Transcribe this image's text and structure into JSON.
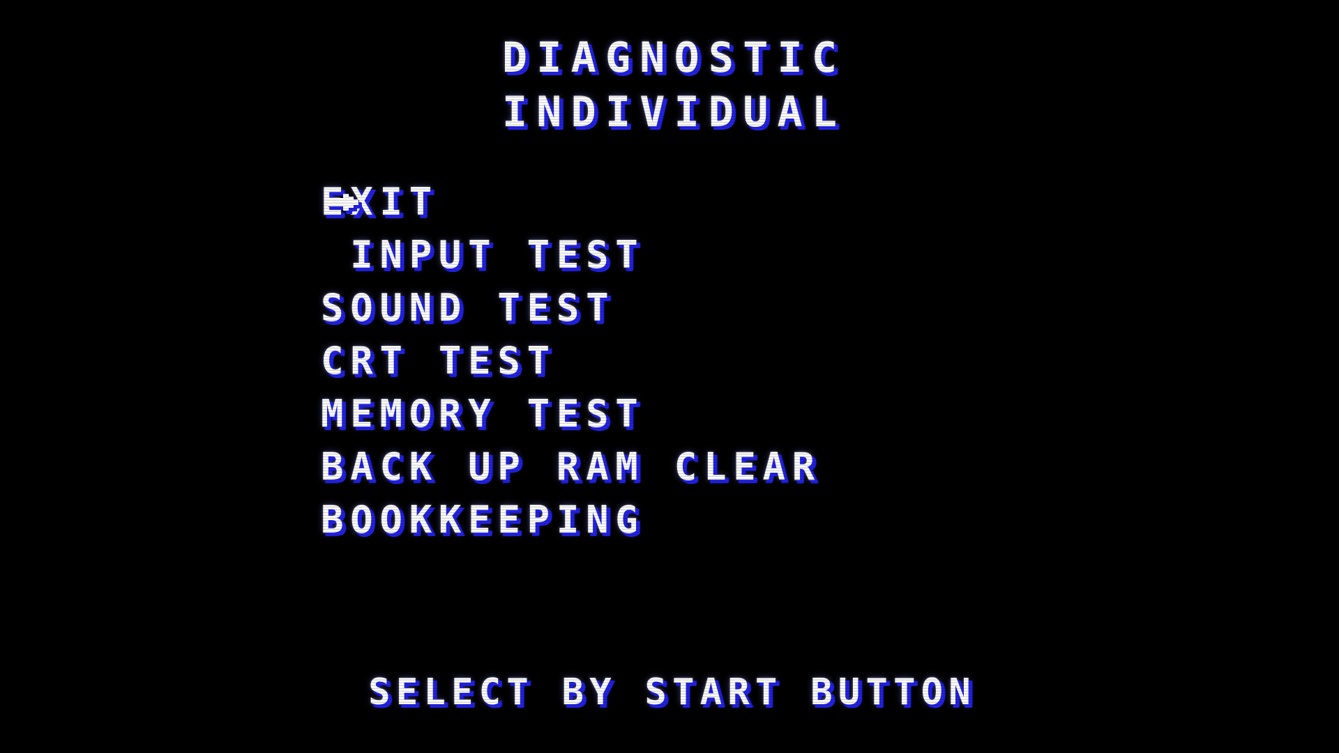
{
  "screen": {
    "background_color": "#000000",
    "text_color": "#ffffff",
    "shadow_color": "#2222e6"
  },
  "title": {
    "line1": "DIAGNOSTIC",
    "line2": "INDIVIDUAL"
  },
  "cursor": {
    "icon": "arrow-right-icon",
    "selected_index": 0
  },
  "menu": {
    "items": [
      {
        "label": "EXIT",
        "selected": true
      },
      {
        "label": " INPUT TEST",
        "selected": false
      },
      {
        "label": "SOUND TEST",
        "selected": false
      },
      {
        "label": "CRT TEST",
        "selected": false
      },
      {
        "label": "MEMORY TEST",
        "selected": false
      },
      {
        "label": "BACK UP RAM CLEAR",
        "selected": false
      },
      {
        "label": "BOOKKEEPING",
        "selected": false
      }
    ]
  },
  "footer": {
    "hint": "SELECT BY START BUTTON"
  }
}
